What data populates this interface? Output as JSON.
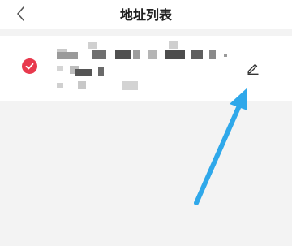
{
  "header": {
    "title": "地址列表",
    "back_icon": "chevron-left-icon"
  },
  "address_list": {
    "items": [
      {
        "selected": true,
        "check_icon": "check-circle-icon",
        "edit_icon": "pencil-icon",
        "details_obscured": true
      }
    ]
  },
  "annotation": {
    "arrow_color": "#2fa8ea",
    "arrow_icon": "arrow-icon"
  },
  "colors": {
    "accent": "#e8394d",
    "background": "#f3f3f3",
    "card": "#ffffff"
  }
}
